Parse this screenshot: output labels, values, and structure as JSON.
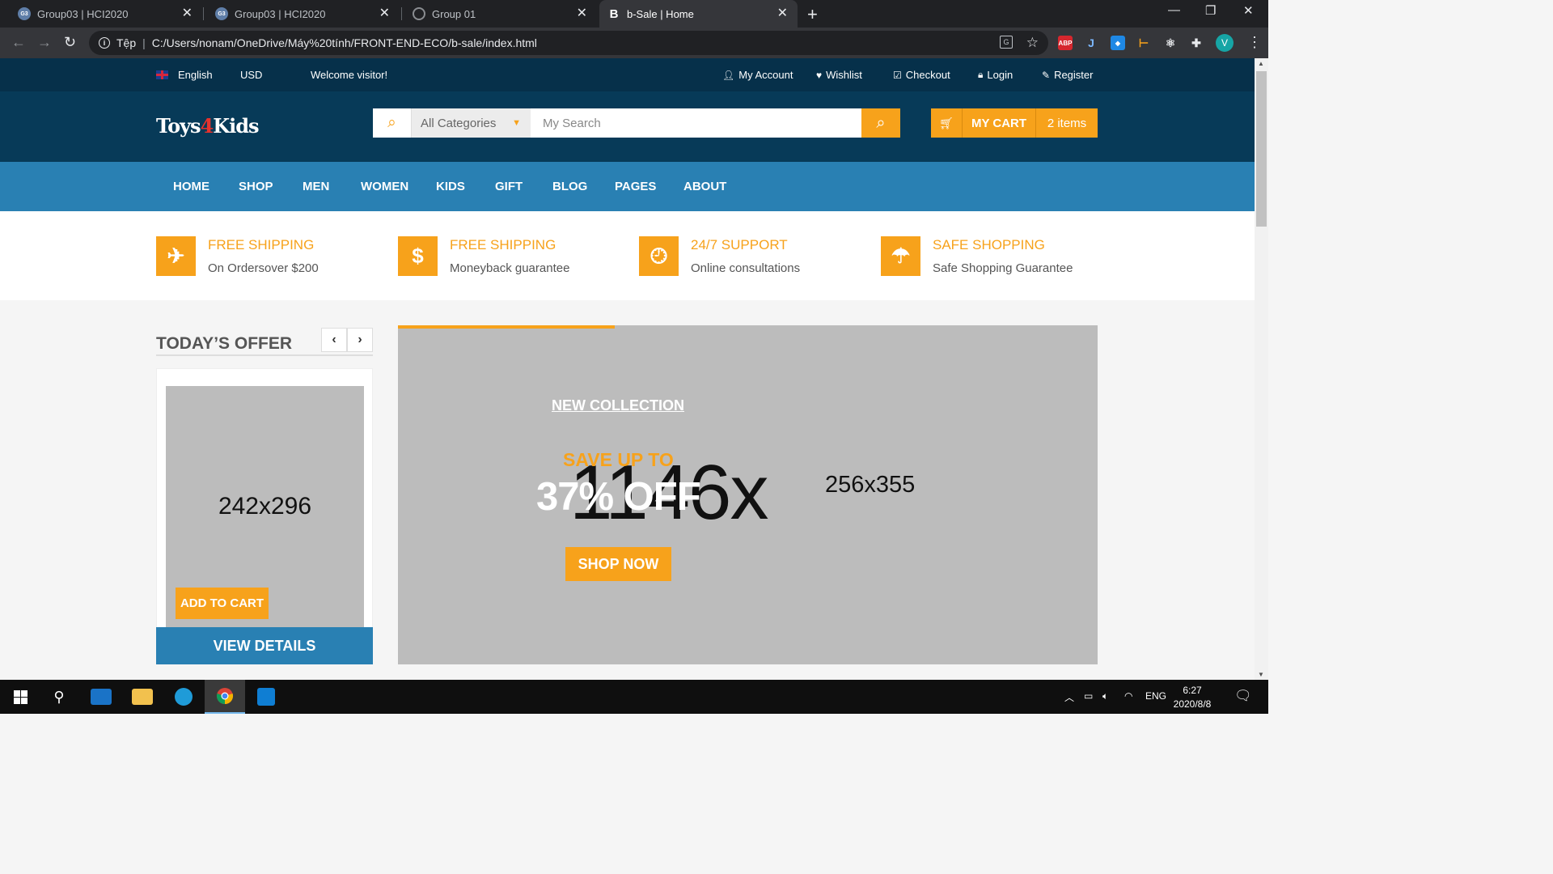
{
  "browser": {
    "tabs": [
      {
        "title": "Group03 | HCI2020",
        "favicon": "G3"
      },
      {
        "title": "Group03 | HCI2020",
        "favicon": "G3"
      },
      {
        "title": "Group 01",
        "favicon": ""
      },
      {
        "title": "b-Sale | Home",
        "favicon": "B"
      }
    ],
    "url_prefix": "Tệp",
    "url": "C:/Users/nonam/OneDrive/Máy%20tính/FRONT-END-ECO/b-sale/index.html",
    "extensions": [
      "ABP",
      "J",
      "◆",
      "⊢",
      "⚛",
      "✚"
    ],
    "profile_initial": "V"
  },
  "topbar": {
    "language": "English",
    "currency": "USD",
    "welcome": "Welcome visitor!",
    "links": [
      "My Account",
      "Wishlist",
      "Checkout",
      "Login",
      "Register"
    ]
  },
  "header": {
    "logo_part1": "Toys",
    "logo_part2": "4",
    "logo_part3": "Kids",
    "category": "All Categories",
    "search_placeholder": "My Search",
    "cart_label": "MY CART",
    "cart_count": "2 items"
  },
  "nav": [
    "HOME",
    "SHOP",
    "MEN",
    "WOMEN",
    "KIDS",
    "GIFT",
    "BLOG",
    "PAGES",
    "ABOUT"
  ],
  "features": [
    {
      "icon": "plane-icon",
      "title": "FREE SHIPPING",
      "subtitle": "On Ordersover $200"
    },
    {
      "icon": "dollar-icon",
      "title": "FREE SHIPPING",
      "subtitle": "Moneyback guarantee"
    },
    {
      "icon": "clock-icon",
      "title": "24/7 SUPPORT",
      "subtitle": "Online consultations"
    },
    {
      "icon": "umbrella-icon",
      "title": "SAFE SHOPPING",
      "subtitle": "Safe Shopping Guarantee"
    }
  ],
  "offer": {
    "title": "TODAY’S OFFER",
    "image_placeholder": "242x296",
    "add_to_cart": "ADD TO CART",
    "view_details": "VIEW DETAILS"
  },
  "slider": {
    "big_placeholder": "1146x",
    "small_placeholder": "256x355",
    "new_collection": "NEW COLLECTION",
    "save_up_to": "SAVE UP TO",
    "discount": "37% OFF",
    "shop_now": "SHOP NOW",
    "progress": 0.31
  },
  "taskbar": {
    "language": "ENG",
    "time": "6:27",
    "date": "2020/8/8"
  },
  "colors": {
    "accent": "#f7a21b",
    "header": "#073a58",
    "nav": "#2980b3"
  }
}
